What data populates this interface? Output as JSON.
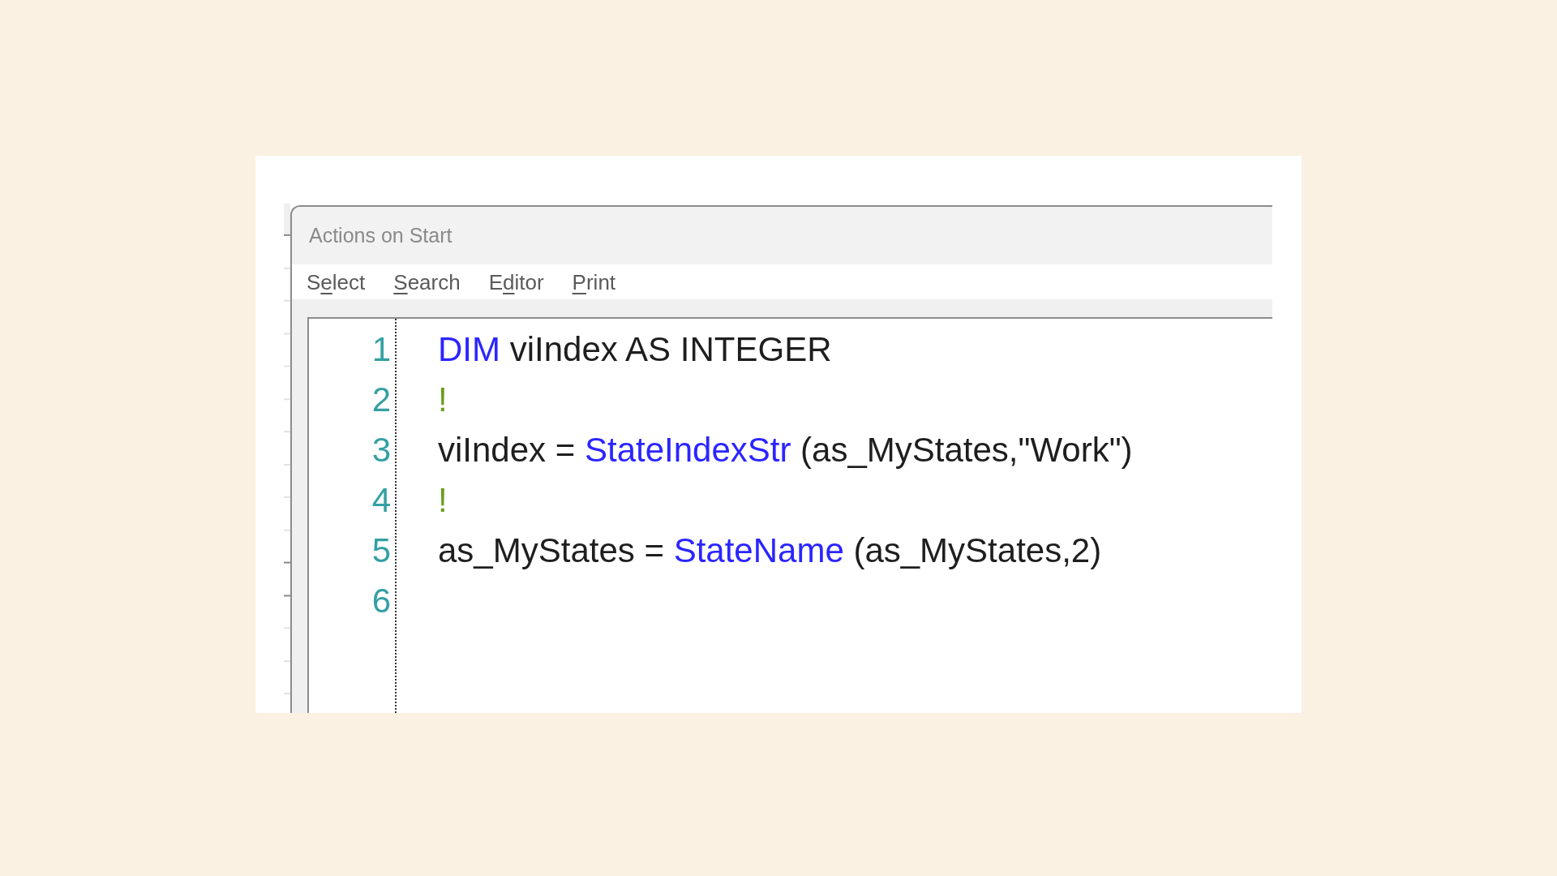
{
  "window": {
    "title": "Actions on Start"
  },
  "menu": [
    {
      "parts": [
        {
          "text": "S",
          "underlined": false
        },
        {
          "text": "e",
          "underlined": true
        },
        {
          "text": "lect",
          "underlined": false
        }
      ]
    },
    {
      "parts": [
        {
          "text": "S",
          "underlined": true
        },
        {
          "text": "earch",
          "underlined": false
        }
      ]
    },
    {
      "parts": [
        {
          "text": "E",
          "underlined": false
        },
        {
          "text": "d",
          "underlined": true
        },
        {
          "text": "itor",
          "underlined": false
        }
      ]
    },
    {
      "parts": [
        {
          "text": "P",
          "underlined": true
        },
        {
          "text": "rint",
          "underlined": false
        }
      ]
    }
  ],
  "editor": {
    "lines": [
      {
        "number": "1",
        "tokens": [
          {
            "kind": "keyword",
            "text": "DIM"
          },
          {
            "kind": "plain",
            "text": " viIndex AS INTEGER"
          }
        ]
      },
      {
        "number": "2",
        "tokens": [
          {
            "kind": "comment",
            "text": "!"
          }
        ]
      },
      {
        "number": "3",
        "tokens": [
          {
            "kind": "plain",
            "text": "viIndex = "
          },
          {
            "kind": "keyword",
            "text": "StateIndexStr"
          },
          {
            "kind": "plain",
            "text": " (as_MyStates,\"Work\")"
          }
        ]
      },
      {
        "number": "4",
        "tokens": [
          {
            "kind": "comment",
            "text": "!"
          }
        ]
      },
      {
        "number": "5",
        "tokens": [
          {
            "kind": "plain",
            "text": "as_MyStates = "
          },
          {
            "kind": "keyword",
            "text": "StateName"
          },
          {
            "kind": "plain",
            "text": " (as_MyStates,2)"
          }
        ]
      },
      {
        "number": "6"
      }
    ]
  }
}
